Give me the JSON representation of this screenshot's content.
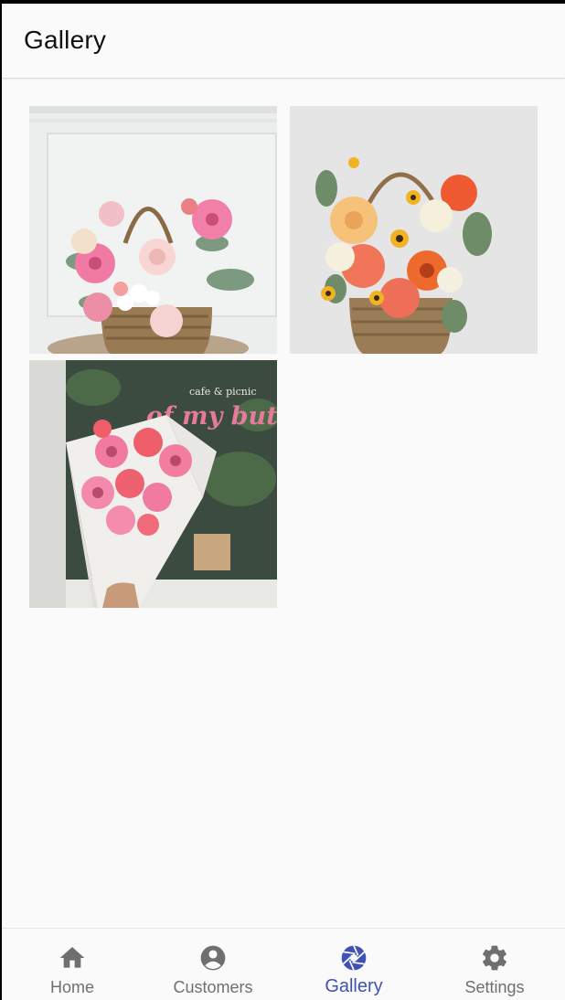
{
  "app_bar": {
    "title": "Gallery"
  },
  "gallery": {
    "images": [
      {
        "subject": "pink gerbera and rose basket",
        "icon": "image"
      },
      {
        "subject": "orange carnation and sunflower basket",
        "icon": "image"
      },
      {
        "subject": "pink gerbera bouquet in front of cafe window",
        "icon": "image",
        "sign_text": "of my butter",
        "sign_small": "cafe & picnic"
      }
    ]
  },
  "bottom_nav": {
    "items": [
      {
        "label": "Home",
        "icon": "home-icon"
      },
      {
        "label": "Customers",
        "icon": "account-circle-icon"
      },
      {
        "label": "Gallery",
        "icon": "camera-shutter-icon",
        "active": true
      },
      {
        "label": "Settings",
        "icon": "gear-icon"
      }
    ],
    "active_color": "#3f51b5",
    "inactive_color": "#6f6f6f"
  }
}
